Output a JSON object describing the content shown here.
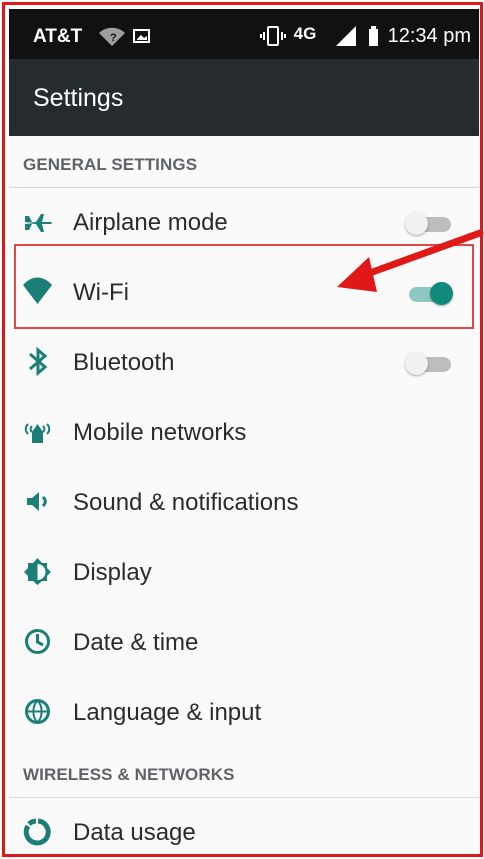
{
  "status_bar": {
    "carrier": "AT&T",
    "network_badge": "4G",
    "time": "12:34 pm",
    "icons": [
      "wifi-question-icon",
      "image-notification-icon",
      "vibrate-icon",
      "lte-icon",
      "signal-icon",
      "battery-icon"
    ]
  },
  "toolbar": {
    "title": "Settings"
  },
  "sections": {
    "general": "GENERAL SETTINGS",
    "wireless": "WIRELESS & NETWORKS"
  },
  "rows": {
    "airplane": {
      "label": "Airplane mode",
      "icon": "airplane-icon",
      "enabled": false
    },
    "wifi": {
      "label": "Wi-Fi",
      "icon": "wifi-icon",
      "enabled": true
    },
    "bluetooth": {
      "label": "Bluetooth",
      "icon": "bluetooth-icon",
      "enabled": false
    },
    "mobile": {
      "label": "Mobile networks",
      "icon": "mobile-networks-icon"
    },
    "sound": {
      "label": "Sound & notifications",
      "icon": "speaker-icon"
    },
    "display": {
      "label": "Display",
      "icon": "display-icon"
    },
    "datetime": {
      "label": "Date & time",
      "icon": "clock-icon"
    },
    "language": {
      "label": "Language & input",
      "icon": "globe-icon"
    },
    "data": {
      "label": "Data usage",
      "icon": "data-usage-icon"
    }
  },
  "colors": {
    "accent": "#1b7f78",
    "toolbar": "#262b2e",
    "annotation": "#e01818"
  }
}
